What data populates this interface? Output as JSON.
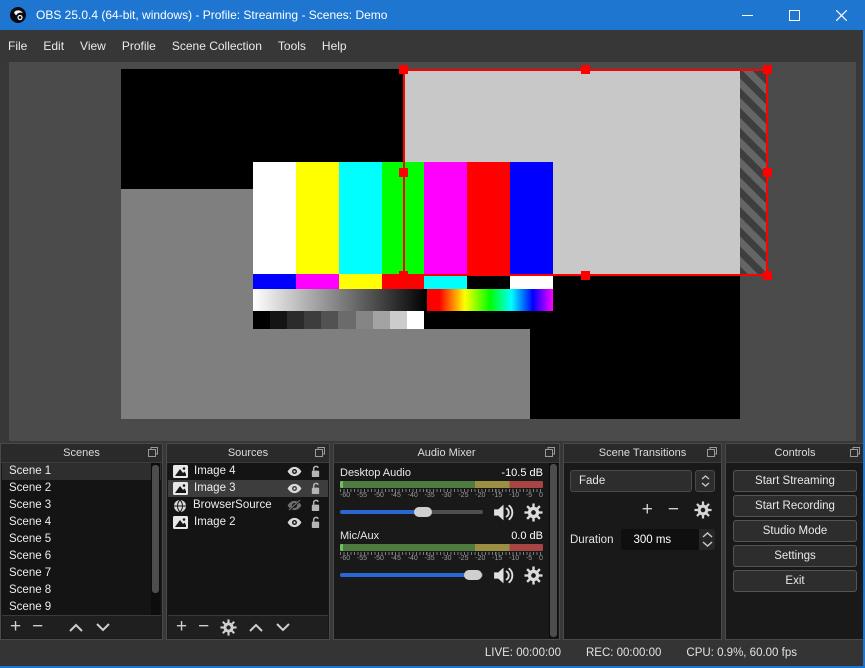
{
  "window": {
    "title": "OBS 25.0.4 (64-bit, windows) - Profile: Streaming - Scenes: Demo",
    "accent_color": "#1e76d0"
  },
  "menu": {
    "items": [
      "File",
      "Edit",
      "View",
      "Profile",
      "Scene Collection",
      "Tools",
      "Help"
    ]
  },
  "preview": {
    "background_color": "#4b4b4b",
    "canvas_color": "#000000",
    "selection_color": "#ff0000",
    "gray_source_color": "#7f7f7f",
    "light_source_color": "#c8c8c8",
    "test_pattern": {
      "bars": [
        "#ffffff",
        "#ffff00",
        "#00ffff",
        "#00ff00",
        "#ff00ff",
        "#ff0000",
        "#0000ff"
      ],
      "row2": [
        "#0000ff",
        "#ff00ff",
        "#ffff00",
        "#ff0000",
        "#00ffff",
        "#000000",
        "#ffffff"
      ],
      "steps": [
        "#000000",
        "#141414",
        "#2b2b2b",
        "#3d3d3d",
        "#525252",
        "#6b6b6b",
        "#858585",
        "#a3a3a3",
        "#cccccc",
        "#ffffff"
      ]
    }
  },
  "scenes": {
    "title": "Scenes",
    "items": [
      "Scene 1",
      "Scene 2",
      "Scene 3",
      "Scene 4",
      "Scene 5",
      "Scene 6",
      "Scene 7",
      "Scene 8",
      "Scene 9"
    ],
    "selected": "Scene 1"
  },
  "sources": {
    "title": "Sources",
    "items": [
      {
        "name": "Image 4",
        "icon": "image",
        "visible": true,
        "locked": false
      },
      {
        "name": "Image 3",
        "icon": "image",
        "visible": true,
        "locked": false,
        "selected": true
      },
      {
        "name": "BrowserSource",
        "icon": "globe",
        "visible": false,
        "locked": false
      },
      {
        "name": "Image 2",
        "icon": "image",
        "visible": true,
        "locked": false
      }
    ]
  },
  "audio_mixer": {
    "title": "Audio Mixer",
    "scale": [
      "-60",
      "-55",
      "-50",
      "-45",
      "-40",
      "-35",
      "-30",
      "-25",
      "-20",
      "-15",
      "-10",
      "-5",
      "0"
    ],
    "channels": [
      {
        "name": "Desktop Audio",
        "level": "-10.5 dB",
        "slider_percent": 58
      },
      {
        "name": "Mic/Aux",
        "level": "0.0 dB",
        "slider_percent": 93
      }
    ],
    "meter_colors": {
      "green": "#4e7c40",
      "yellow": "#9d8f41",
      "red": "#a84444"
    },
    "slider_color": "#2a67d5"
  },
  "transitions": {
    "title": "Scene Transitions",
    "selected_transition": "Fade",
    "duration_label": "Duration",
    "duration_value": "300 ms"
  },
  "controls": {
    "title": "Controls",
    "buttons": [
      "Start Streaming",
      "Start Recording",
      "Studio Mode",
      "Settings",
      "Exit"
    ]
  },
  "status": {
    "live": "LIVE: 00:00:00",
    "rec": "REC: 00:00:00",
    "cpu": "CPU: 0.9%, 60.00 fps"
  },
  "icons": {
    "obs-logo": "dark circle with white swirl",
    "minimize": "horizontal bar",
    "maximize": "hollow square",
    "close": "x cross",
    "popout": "overlapping windows",
    "image-source": "picture glyph",
    "browser-source": "globe glyph",
    "visible": "eye",
    "hidden": "eye with slash",
    "unlocked": "open padlock",
    "volume": "speaker with waves",
    "settings": "gear",
    "add": "+",
    "remove": "−",
    "move-up": "chevron up",
    "move-down": "chevron down"
  }
}
